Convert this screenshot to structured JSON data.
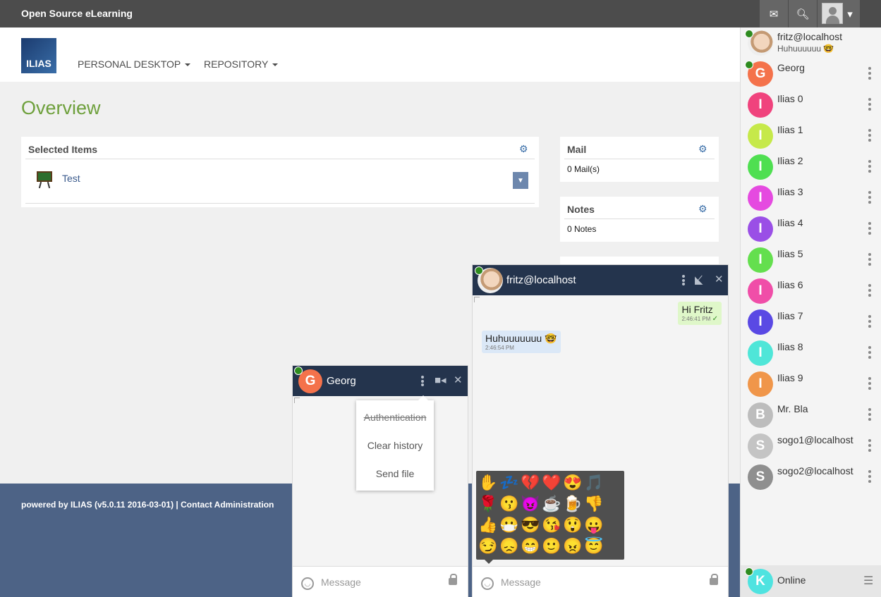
{
  "topbar": {
    "brand": "Open Source eLearning",
    "mail_icon": "mail-icon",
    "search_icon": "search-icon",
    "user_icon": "user-avatar-icon"
  },
  "navbar": {
    "logo": "ILIAS",
    "items": [
      "PERSONAL DESKTOP",
      "REPOSITORY"
    ]
  },
  "main": {
    "title": "Overview",
    "selected_items": {
      "heading": "Selected Items",
      "items": [
        {
          "label": "Test",
          "icon": "course-board-icon"
        }
      ]
    },
    "mail": {
      "heading": "Mail",
      "value": "0 Mail(s)"
    },
    "notes": {
      "heading": "Notes",
      "value": "0 Notes"
    }
  },
  "footer": {
    "text": "powered by ILIAS (v5.0.11 2016-03-01) | Contact Administration"
  },
  "roster": {
    "me": {
      "name": "fritz@localhost",
      "status": "Huhuuuuuu",
      "status_emoji": "🤓"
    },
    "contacts": [
      {
        "name": "Georg",
        "initial": "G",
        "color": "#f4724b",
        "online": true
      },
      {
        "name": "Ilias 0",
        "initial": "I",
        "color": "#f0437d",
        "online": false
      },
      {
        "name": "Ilias 1",
        "initial": "I",
        "color": "#c6e94a",
        "online": false
      },
      {
        "name": "Ilias 2",
        "initial": "I",
        "color": "#4fdf51",
        "online": false
      },
      {
        "name": "Ilias 3",
        "initial": "I",
        "color": "#e54ae0",
        "online": false
      },
      {
        "name": "Ilias 4",
        "initial": "I",
        "color": "#9a4fe6",
        "online": false
      },
      {
        "name": "Ilias 5",
        "initial": "I",
        "color": "#64df4e",
        "online": false
      },
      {
        "name": "Ilias 6",
        "initial": "I",
        "color": "#f04ea8",
        "online": false
      },
      {
        "name": "Ilias 7",
        "initial": "I",
        "color": "#5a49e4",
        "online": false
      },
      {
        "name": "Ilias 8",
        "initial": "I",
        "color": "#4fe6d8",
        "online": false
      },
      {
        "name": "Ilias 9",
        "initial": "I",
        "color": "#f0964a",
        "online": false
      },
      {
        "name": "Mr. Bla",
        "initial": "B",
        "color": "#bdbdbd",
        "online": false
      },
      {
        "name": "sogo1@localhost",
        "initial": "S",
        "color": "#c4c4c4",
        "online": false
      },
      {
        "name": "sogo2@localhost",
        "initial": "S",
        "color": "#8f8f8f",
        "online": false
      }
    ],
    "status_bar": {
      "initial": "K",
      "color": "#4fe3e0",
      "label": "Online"
    }
  },
  "chat_georg": {
    "title": "Georg",
    "initial": "G",
    "menu": [
      "Authentication",
      "Clear history",
      "Send file"
    ],
    "input_placeholder": "Message"
  },
  "chat_fritz": {
    "title": "fritz@localhost",
    "messages": [
      {
        "text": "Hi Fritz",
        "time": "2:46:41 PM",
        "check": "✓",
        "own": true
      },
      {
        "text": "Huhuuuuuuu",
        "emoji": "🤓",
        "time": "2:46:54 PM",
        "own": false
      }
    ],
    "emojis": [
      "✋",
      "💤",
      "💔",
      "❤️",
      "😍",
      "🎵",
      "🌹",
      "😗",
      "😈",
      "☕",
      "🍺",
      "👎",
      "👍",
      "😷",
      "😎",
      "😘",
      "😲",
      "😛",
      "😏",
      "😞",
      "😁",
      "🙂",
      "😠",
      "😇"
    ],
    "input_placeholder": "Message"
  }
}
